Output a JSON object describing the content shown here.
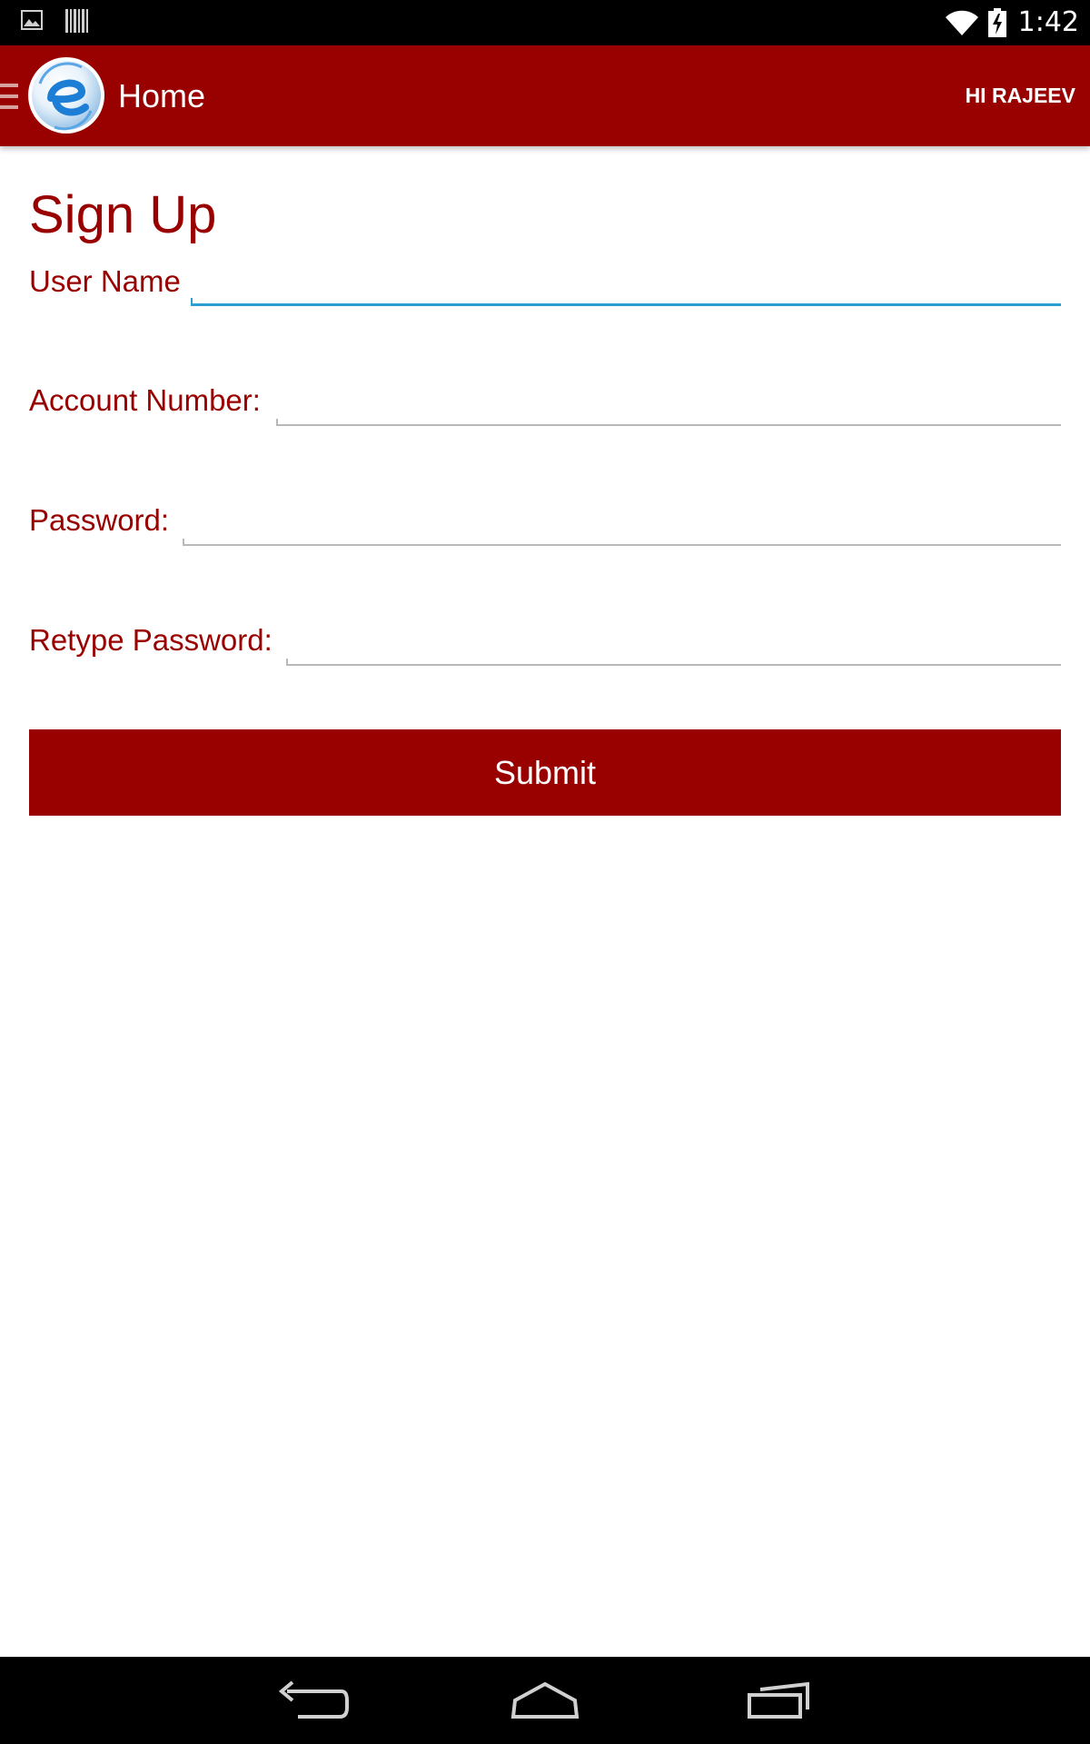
{
  "status_bar": {
    "time": "1:42",
    "left_icons": [
      "image-notification-icon",
      "barcode-notification-icon"
    ],
    "right_icons": [
      "wifi-icon",
      "battery-charging-icon"
    ]
  },
  "app_bar": {
    "title": "Home",
    "greeting": "HI RAJEEV",
    "background_color": "#990000",
    "icons": [
      "drawer-menu-icon",
      "app-logo-e-icon"
    ]
  },
  "form": {
    "title": "Sign Up",
    "accent_color": "#990000",
    "fields": [
      {
        "label": "User Name",
        "value": "",
        "focused": true
      },
      {
        "label": "Account Number:",
        "value": ""
      },
      {
        "label": "Password:",
        "value": ""
      },
      {
        "label": "Retype Password:",
        "value": ""
      }
    ],
    "submit_label": "Submit"
  },
  "nav_bar": {
    "icons": [
      "back-icon",
      "home-icon",
      "recent-apps-icon"
    ]
  }
}
